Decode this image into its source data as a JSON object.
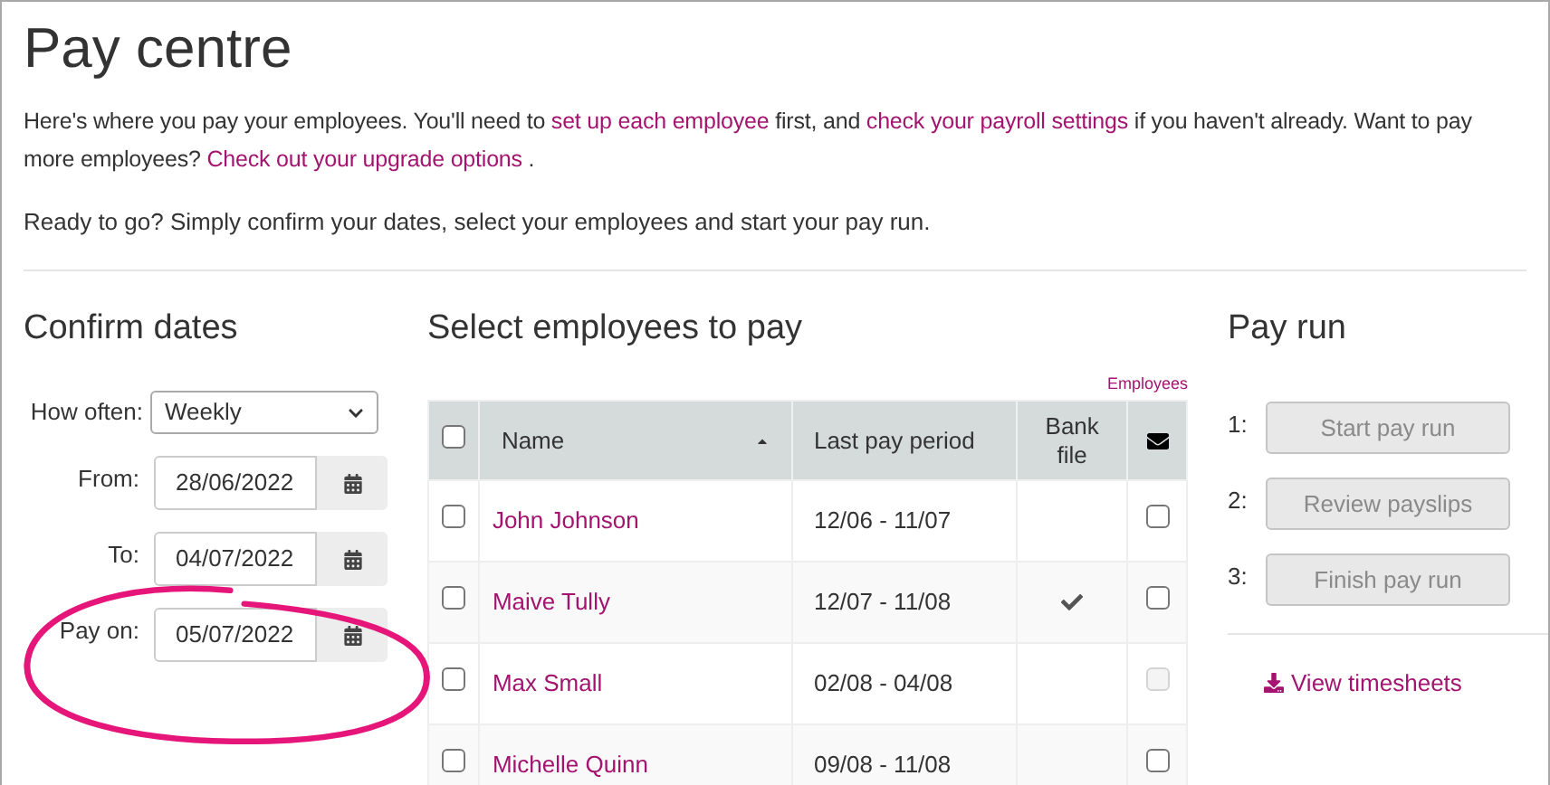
{
  "title": "Pay centre",
  "intro": [
    "Here's where you pay your employees. You'll need to ",
    {
      "link": "set up each employee"
    },
    " first, and ",
    {
      "link": "check your payroll settings"
    },
    " if you haven't already. Want to pay more employees? ",
    {
      "link": "Check out your upgrade options"
    },
    " ."
  ],
  "ready_text": "Ready to go? Simply confirm your dates, select your employees and start your pay run.",
  "confirm_dates": {
    "heading": "Confirm dates",
    "how_often": {
      "label": "How often:",
      "value": "Weekly"
    },
    "dates": [
      {
        "label": "From:",
        "value": "28/06/2022"
      },
      {
        "label": "To:",
        "value": "04/07/2022"
      },
      {
        "label": "Pay on:",
        "value": "05/07/2022"
      }
    ]
  },
  "employees": {
    "heading": "Select employees to pay",
    "link": "Employees",
    "columns": [
      "Name",
      "Last pay period",
      "Bank file"
    ],
    "select_all_checked": false,
    "rows": [
      {
        "name": "John Johnson",
        "period": "12/06 - 11/07",
        "checked": false,
        "bank_file": false,
        "email_checked": false,
        "email_disabled": false
      },
      {
        "name": "Maive Tully",
        "period": "12/07 - 11/08",
        "checked": false,
        "bank_file": true,
        "email_checked": false,
        "email_disabled": false
      },
      {
        "name": "Max Small",
        "period": "02/08 - 04/08",
        "checked": false,
        "bank_file": false,
        "email_checked": false,
        "email_disabled": true
      },
      {
        "name": "Michelle Quinn",
        "period": "09/08 - 11/08",
        "checked": false,
        "bank_file": false,
        "email_checked": false,
        "email_disabled": false
      }
    ]
  },
  "pay_run": {
    "heading": "Pay run",
    "steps": [
      {
        "number": "1:",
        "label": "Start pay run",
        "disabled": true
      },
      {
        "number": "2:",
        "label": "Review payslips",
        "disabled": true
      },
      {
        "number": "3:",
        "label": "Finish pay run",
        "disabled": true
      }
    ],
    "timesheets_link": "View timesheets"
  }
}
